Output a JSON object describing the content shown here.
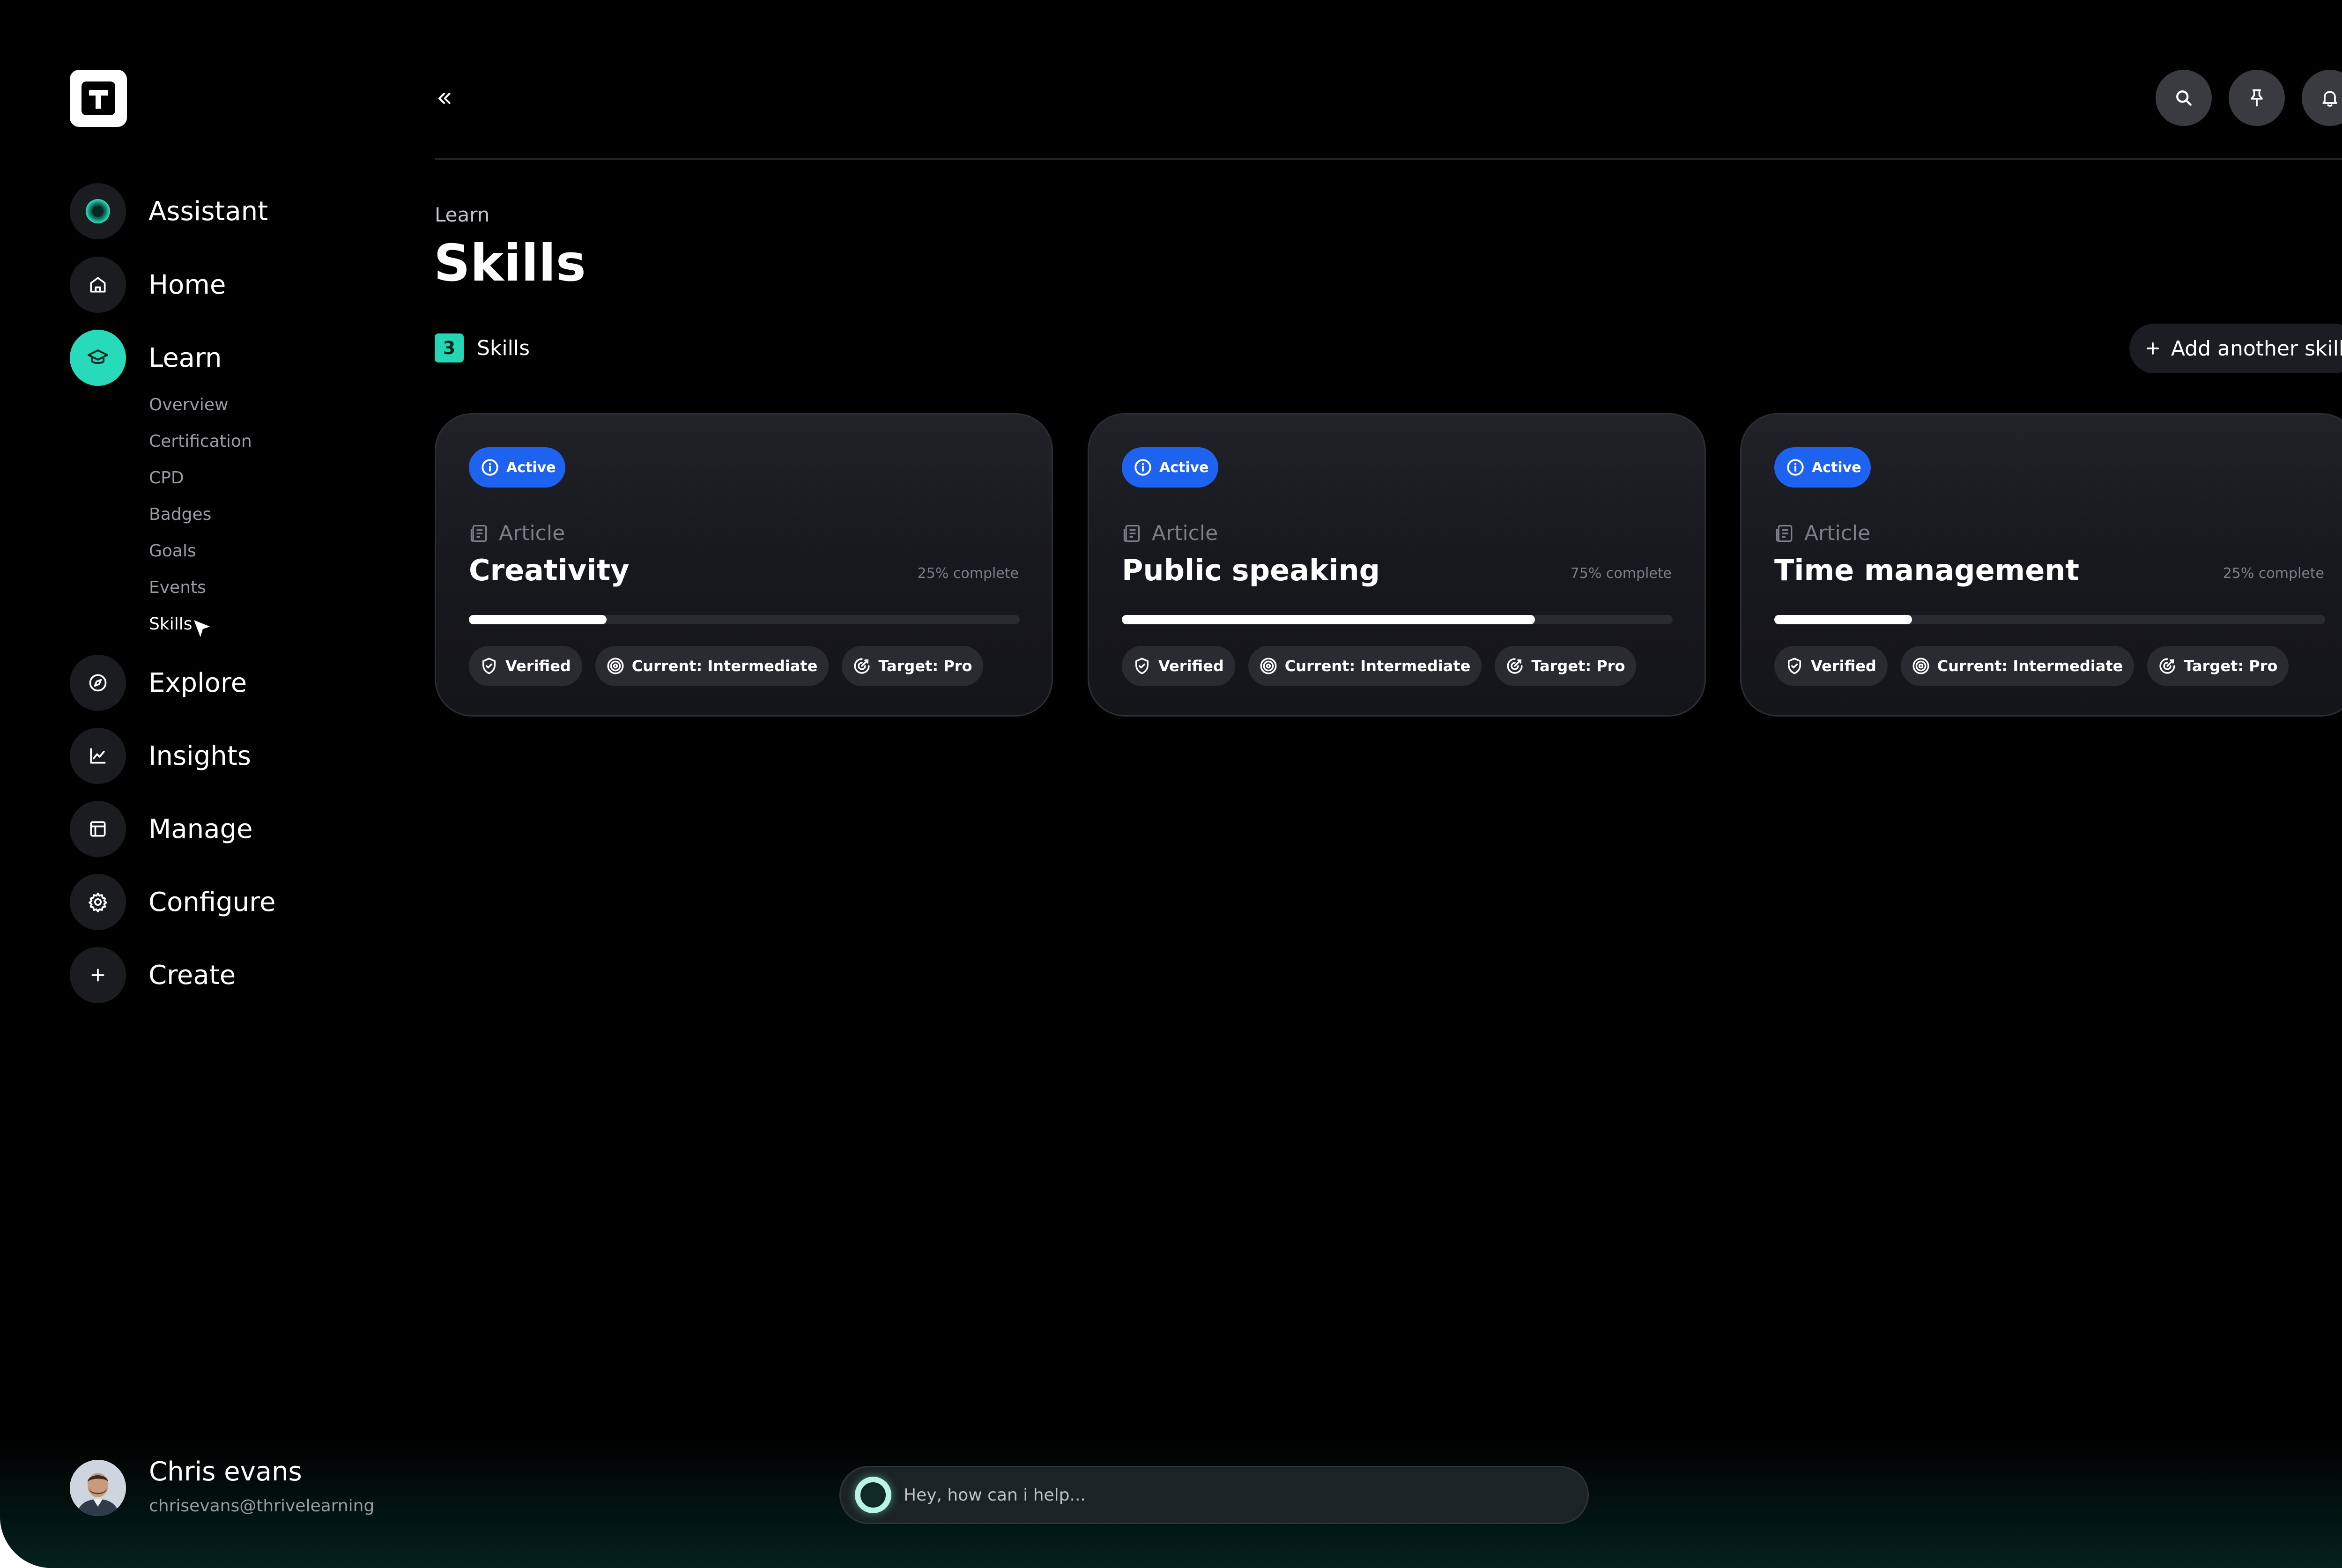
{
  "logo": {
    "letter": "T"
  },
  "nav": {
    "items": [
      {
        "label": "Assistant",
        "icon": "assistant-orb-icon"
      },
      {
        "label": "Home",
        "icon": "home-icon"
      },
      {
        "label": "Learn",
        "icon": "graduation-cap-icon",
        "active": true
      },
      {
        "label": "Explore",
        "icon": "compass-icon"
      },
      {
        "label": "Insights",
        "icon": "chart-line-icon"
      },
      {
        "label": "Manage",
        "icon": "layout-icon"
      },
      {
        "label": "Configure",
        "icon": "gear-icon"
      },
      {
        "label": "Create",
        "icon": "plus-icon"
      }
    ],
    "learn_subitems": [
      "Overview",
      "Certification",
      "CPD",
      "Badges",
      "Goals",
      "Events",
      "Skills"
    ],
    "current_subitem": "Skills"
  },
  "header": {
    "icons": [
      "double-chevron-left-icon",
      "search-icon",
      "pin-icon",
      "bell-icon"
    ]
  },
  "page": {
    "breadcrumb": "Learn",
    "title": "Skills",
    "count": "3",
    "count_label": "Skills",
    "add_button": "Add another skill"
  },
  "cards": [
    {
      "status": "Active",
      "type": "Article",
      "title": "Creativity",
      "complete": "25% complete",
      "progress": 0.25,
      "tags": [
        "Verified",
        "Current: Intermediate",
        "Target: Pro"
      ]
    },
    {
      "status": "Active",
      "type": "Article",
      "title": "Public speaking",
      "complete": "75% complete",
      "progress": 0.75,
      "tags": [
        "Verified",
        "Current: Intermediate",
        "Target: Pro"
      ]
    },
    {
      "status": "Active",
      "type": "Article",
      "title": "Time management",
      "complete": "25% complete",
      "progress": 0.25,
      "tags": [
        "Verified",
        "Current: Intermediate",
        "Target: Pro"
      ]
    }
  ],
  "user": {
    "name": "Chris evans",
    "email": "chrisevans@thrivelearning"
  },
  "assistant": {
    "placeholder": "Hey, how can i help..."
  },
  "colors": {
    "accent": "#27dbba",
    "active_badge": "#1e63ef",
    "background": "#000000"
  }
}
